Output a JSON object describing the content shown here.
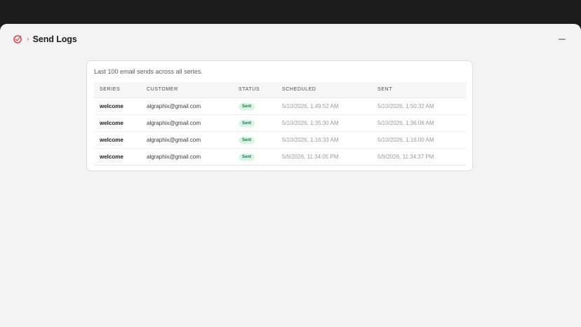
{
  "header": {
    "title": "Send Logs",
    "separator": "›",
    "accent": "#e5484d"
  },
  "card": {
    "description": "Last 100 email sends across all series."
  },
  "table": {
    "columns": [
      "SERIES",
      "CUSTOMER",
      "STATUS",
      "SCHEDULED",
      "SENT"
    ],
    "rows": [
      {
        "series": "welcome",
        "customer": "algraphix@gmail.com",
        "status": "Sent",
        "scheduled": "5/10/2026, 1:49:52 AM",
        "sent": "5/10/2026, 1:50:32 AM"
      },
      {
        "series": "welcome",
        "customer": "algraphix@gmail.com",
        "status": "Sent",
        "scheduled": "5/10/2026, 1:35:30 AM",
        "sent": "5/10/2026, 1:36:06 AM"
      },
      {
        "series": "welcome",
        "customer": "algraphix@gmail.com",
        "status": "Sent",
        "scheduled": "5/10/2026, 1:16:33 AM",
        "sent": "5/10/2026, 1:16:00 AM"
      },
      {
        "series": "welcome",
        "customer": "algraphix@gmail.com",
        "status": "Sent",
        "scheduled": "5/9/2026, 11:34:05 PM",
        "sent": "5/9/2026, 11:34:37 PM"
      }
    ]
  },
  "colors": {
    "status_sent_bg": "#d8f5e2",
    "status_sent_text": "#17794a"
  }
}
